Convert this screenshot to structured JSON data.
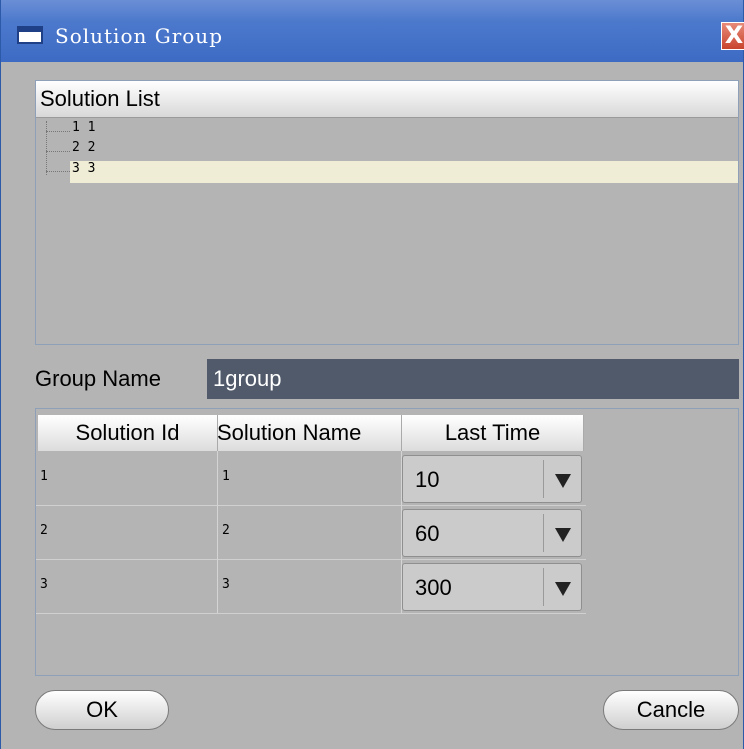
{
  "window": {
    "title": "Solution Group",
    "close_glyph": "X"
  },
  "solution_list": {
    "header": "Solution List",
    "items": [
      {
        "label": "1 1",
        "selected": false
      },
      {
        "label": "2 2",
        "selected": false
      },
      {
        "label": "3 3",
        "selected": true
      }
    ]
  },
  "group": {
    "label": "Group Name",
    "value": "1group"
  },
  "table": {
    "columns": [
      "Solution Id",
      "Solution Name",
      "Last Time"
    ],
    "rows": [
      {
        "id": "1",
        "name": "1",
        "last_time": "10"
      },
      {
        "id": "2",
        "name": "2",
        "last_time": "60"
      },
      {
        "id": "3",
        "name": "3",
        "last_time": "300"
      }
    ]
  },
  "buttons": {
    "ok": "OK",
    "cancel": "Cancle"
  },
  "colors": {
    "titlebar": "#4c79cc",
    "panel_bg": "#b4b4b4",
    "input_bg": "#505a6a",
    "selection": "#efedd6"
  }
}
